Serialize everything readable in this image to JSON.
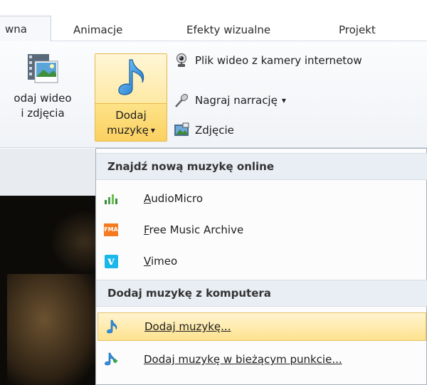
{
  "tabs": [
    {
      "label": "wna",
      "active": true
    },
    {
      "label": "Animacje",
      "active": false
    },
    {
      "label": "Efekty wizualne",
      "active": false
    },
    {
      "label": "Projekt",
      "active": false
    }
  ],
  "ribbon": {
    "add_video": {
      "line1": "odaj wideo",
      "line2": "i zdjęcia",
      "icon": "film-photo-icon"
    },
    "add_music": {
      "line1": "Dodaj",
      "line2": "muzykę",
      "dropdown": "▾",
      "icon": "music-note-icon"
    },
    "webcam": {
      "label": "Plik wideo z kamery internetow",
      "icon": "webcam-icon"
    },
    "narration": {
      "label": "Nagraj narrację",
      "dropdown": "▾",
      "icon": "microphone-icon"
    },
    "snapshot": {
      "label": "Zdjęcie",
      "icon": "snapshot-icon"
    }
  },
  "menu": {
    "online_header": "Znajdź nową muzykę online",
    "online_items": [
      {
        "accel": "A",
        "rest": "udioMicro",
        "icon": "audiomicro-icon"
      },
      {
        "accel": "F",
        "rest": "ree Music Archive",
        "icon": "fma-icon",
        "icon_text": "FMA"
      },
      {
        "accel": "V",
        "rest": "imeo",
        "icon": "vimeo-icon",
        "icon_text": "v"
      }
    ],
    "computer_header": "Dodaj muzykę z komputera",
    "computer_items": [
      {
        "label": "Dodaj muzykę...",
        "icon": "music-note-icon",
        "highlighted": true
      },
      {
        "label": "Dodaj muzykę w bieżącym punkcie...",
        "icon": "music-note-plus-icon",
        "highlighted": false
      }
    ]
  },
  "colors": {
    "highlight": "#fde28f",
    "button_border": "#e6b94a",
    "vimeo_blue": "#1ab7ea",
    "fma_orange": "#f47a20",
    "audiomicro_green": "#3a8f3a"
  }
}
